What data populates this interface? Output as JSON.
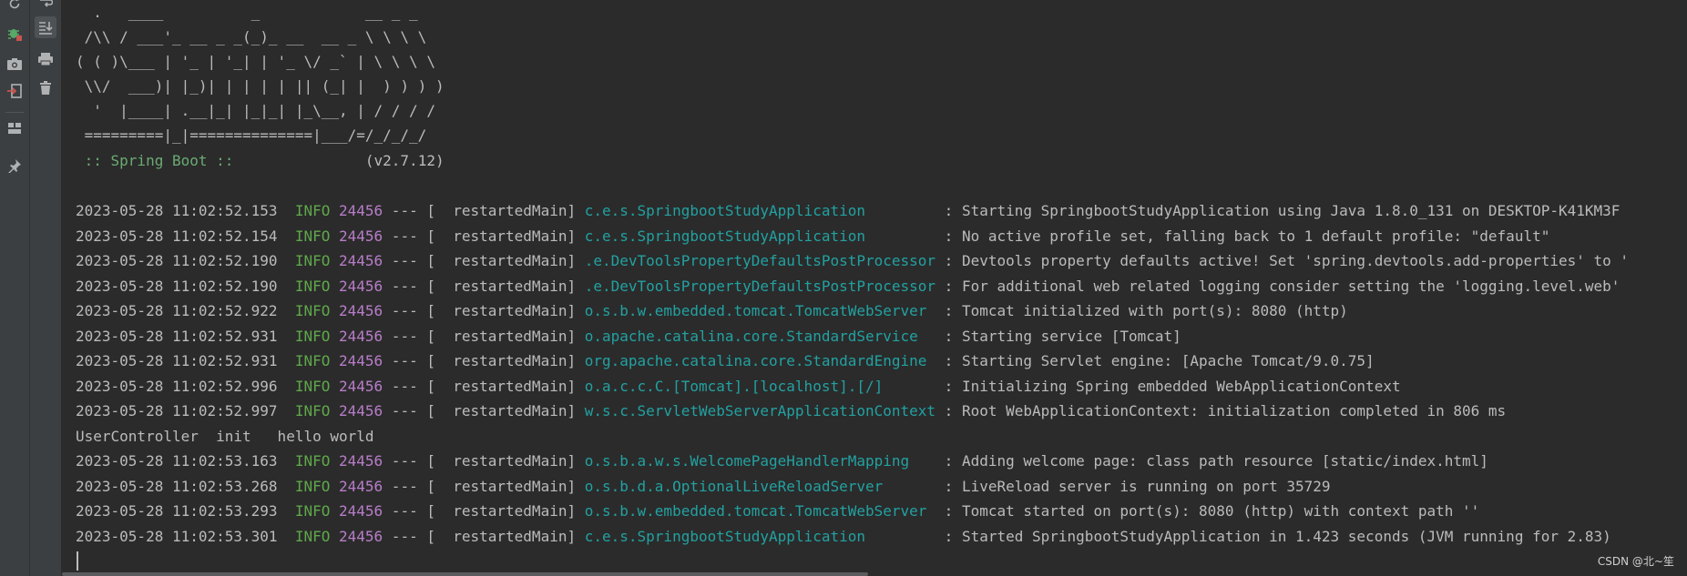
{
  "toolbar_left": {
    "icons": [
      "rerun-icon",
      "debug-icon",
      "camera-icon",
      "exit-icon",
      "layout-icon",
      "pin-icon"
    ]
  },
  "toolbar_second": {
    "icons": [
      "soft-wrap-icon",
      "scroll-to-end-icon",
      "print-icon",
      "clear-icon"
    ]
  },
  "banner": [
    "  .   ____          _            __ _ _",
    " /\\\\ / ___'_ __ _ _(_)_ __  __ _ \\ \\ \\ \\",
    "( ( )\\___ | '_ | '_| | '_ \\/ _` | \\ \\ \\ \\",
    " \\\\/  ___)| |_)| | | | | || (_| |  ) ) ) )",
    "  '  |____| .__|_| |_|_| |_\\__, | / / / /",
    " =========|_|==============|___/=/_/_/_/"
  ],
  "spring_boot": {
    "label": " :: Spring Boot :: ",
    "version": "              (v2.7.12)"
  },
  "log_lines": [
    {
      "time": "2023-05-28 11:02:52.153",
      "level": "INFO",
      "pid": "24456",
      "thread": " --- [  restartedMain] ",
      "logger": "c.e.s.SpringbootStudyApplication        ",
      "message": " : Starting SpringbootStudyApplication using Java 1.8.0_131 on DESKTOP-K41KM3F"
    },
    {
      "time": "2023-05-28 11:02:52.154",
      "level": "INFO",
      "pid": "24456",
      "thread": " --- [  restartedMain] ",
      "logger": "c.e.s.SpringbootStudyApplication        ",
      "message": " : No active profile set, falling back to 1 default profile: \"default\""
    },
    {
      "time": "2023-05-28 11:02:52.190",
      "level": "INFO",
      "pid": "24456",
      "thread": " --- [  restartedMain] ",
      "logger": ".e.DevToolsPropertyDefaultsPostProcessor",
      "message": " : Devtools property defaults active! Set 'spring.devtools.add-properties' to '"
    },
    {
      "time": "2023-05-28 11:02:52.190",
      "level": "INFO",
      "pid": "24456",
      "thread": " --- [  restartedMain] ",
      "logger": ".e.DevToolsPropertyDefaultsPostProcessor",
      "message": " : For additional web related logging consider setting the 'logging.level.web'"
    },
    {
      "time": "2023-05-28 11:02:52.922",
      "level": "INFO",
      "pid": "24456",
      "thread": " --- [  restartedMain] ",
      "logger": "o.s.b.w.embedded.tomcat.TomcatWebServer ",
      "message": " : Tomcat initialized with port(s): 8080 (http)"
    },
    {
      "time": "2023-05-28 11:02:52.931",
      "level": "INFO",
      "pid": "24456",
      "thread": " --- [  restartedMain] ",
      "logger": "o.apache.catalina.core.StandardService  ",
      "message": " : Starting service [Tomcat]"
    },
    {
      "time": "2023-05-28 11:02:52.931",
      "level": "INFO",
      "pid": "24456",
      "thread": " --- [  restartedMain] ",
      "logger": "org.apache.catalina.core.StandardEngine ",
      "message": " : Starting Servlet engine: [Apache Tomcat/9.0.75]"
    },
    {
      "time": "2023-05-28 11:02:52.996",
      "level": "INFO",
      "pid": "24456",
      "thread": " --- [  restartedMain] ",
      "logger": "o.a.c.c.C.[Tomcat].[localhost].[/]      ",
      "message": " : Initializing Spring embedded WebApplicationContext"
    },
    {
      "time": "2023-05-28 11:02:52.997",
      "level": "INFO",
      "pid": "24456",
      "thread": " --- [  restartedMain] ",
      "logger": "w.s.c.ServletWebServerApplicationContext",
      "message": " : Root WebApplicationContext: initialization completed in 806 ms"
    }
  ],
  "plain_line": "UserController  init   hello world",
  "log_lines_2": [
    {
      "time": "2023-05-28 11:02:53.163",
      "level": "INFO",
      "pid": "24456",
      "thread": " --- [  restartedMain] ",
      "logger": "o.s.b.a.w.s.WelcomePageHandlerMapping   ",
      "message": " : Adding welcome page: class path resource [static/index.html]"
    },
    {
      "time": "2023-05-28 11:02:53.268",
      "level": "INFO",
      "pid": "24456",
      "thread": " --- [  restartedMain] ",
      "logger": "o.s.b.d.a.OptionalLiveReloadServer      ",
      "message": " : LiveReload server is running on port 35729"
    },
    {
      "time": "2023-05-28 11:02:53.293",
      "level": "INFO",
      "pid": "24456",
      "thread": " --- [  restartedMain] ",
      "logger": "o.s.b.w.embedded.tomcat.TomcatWebServer ",
      "message": " : Tomcat started on port(s): 8080 (http) with context path ''"
    },
    {
      "time": "2023-05-28 11:02:53.301",
      "level": "INFO",
      "pid": "24456",
      "thread": " --- [  restartedMain] ",
      "logger": "c.e.s.SpringbootStudyApplication        ",
      "message": " : Started SpringbootStudyApplication in 1.423 seconds (JVM running for 2.83)"
    }
  ],
  "watermark": "CSDN @北~笙",
  "colors": {
    "background": "#2b2b2b",
    "toolbar": "#3c3f41",
    "text": "#bbbbbb",
    "info": "#5fa84a",
    "pid": "#b87dc9",
    "logger": "#23a1a1",
    "spring_label": "#6aab73"
  }
}
